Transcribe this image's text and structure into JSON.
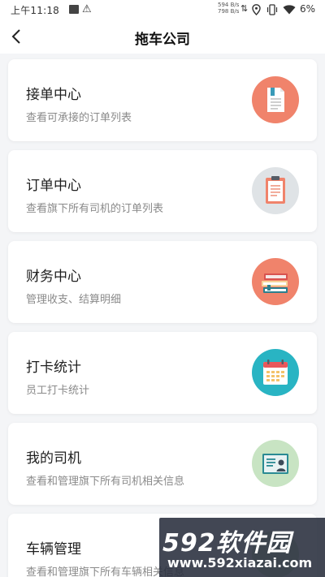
{
  "status_bar": {
    "time": "上午11:18",
    "net_speed_up": "594 B/s",
    "net_speed_down": "798 B/s",
    "battery": "6%"
  },
  "header": {
    "title": "拖车公司"
  },
  "menu": [
    {
      "title": "接单中心",
      "subtitle": "查看可承接的订单列表",
      "icon": "document-icon",
      "color": "#f0836b"
    },
    {
      "title": "订单中心",
      "subtitle": "查看旗下所有司机的订单列表",
      "icon": "clipboard-icon",
      "color": "#dfe3e6"
    },
    {
      "title": "财务中心",
      "subtitle": "管理收支、结算明细",
      "icon": "books-icon",
      "color": "#f0836b"
    },
    {
      "title": "打卡统计",
      "subtitle": "员工打卡统计",
      "icon": "calendar-icon",
      "color": "#29b4c3"
    },
    {
      "title": "我的司机",
      "subtitle": "查看和管理旗下所有司机相关信息",
      "icon": "id-card-icon",
      "color": "#c8e4c3"
    },
    {
      "title": "车辆管理",
      "subtitle": "查看和管理旗下所有车辆相关信息",
      "icon": "vehicle-icon",
      "color": "#c8e4c3"
    }
  ],
  "watermark": {
    "logo": "592软件园",
    "url": "www.592xiazai.com"
  }
}
